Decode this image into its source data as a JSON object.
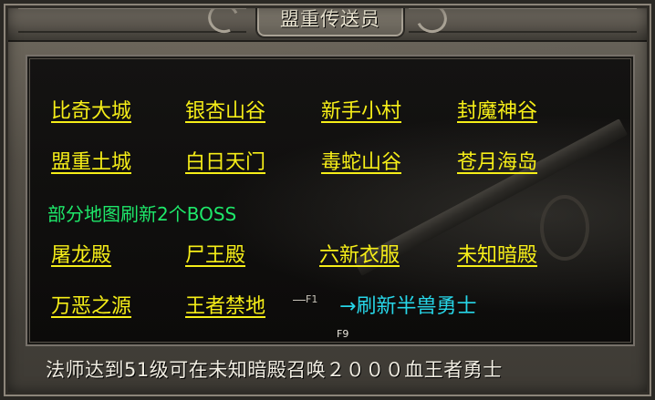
{
  "window": {
    "title": "盟重传送员"
  },
  "destinations": {
    "row1": [
      "比奇大城",
      "银杏山谷",
      "新手小村",
      "封魔神谷"
    ],
    "row2": [
      "盟重土城",
      "白日天门",
      "毒蛇山谷",
      "苍月海岛"
    ],
    "row3": [
      "屠龙殿",
      "尸王殿",
      "六新衣服",
      "未知暗殿"
    ],
    "row4": [
      "万恶之源",
      "王者禁地"
    ]
  },
  "notice": {
    "boss_refresh": "部分地图刷新2个BOSS"
  },
  "special_link": {
    "hotkey_tag": "F1",
    "arrow": "→",
    "label": "刷新半兽勇士"
  },
  "hotkey_hint": "F9",
  "footer": {
    "text": "法师达到51级可在未知暗殿召唤２０００血王者勇士"
  },
  "colors": {
    "link": "#f6ee18",
    "notice": "#1ee86a",
    "special": "#27d6e8"
  }
}
